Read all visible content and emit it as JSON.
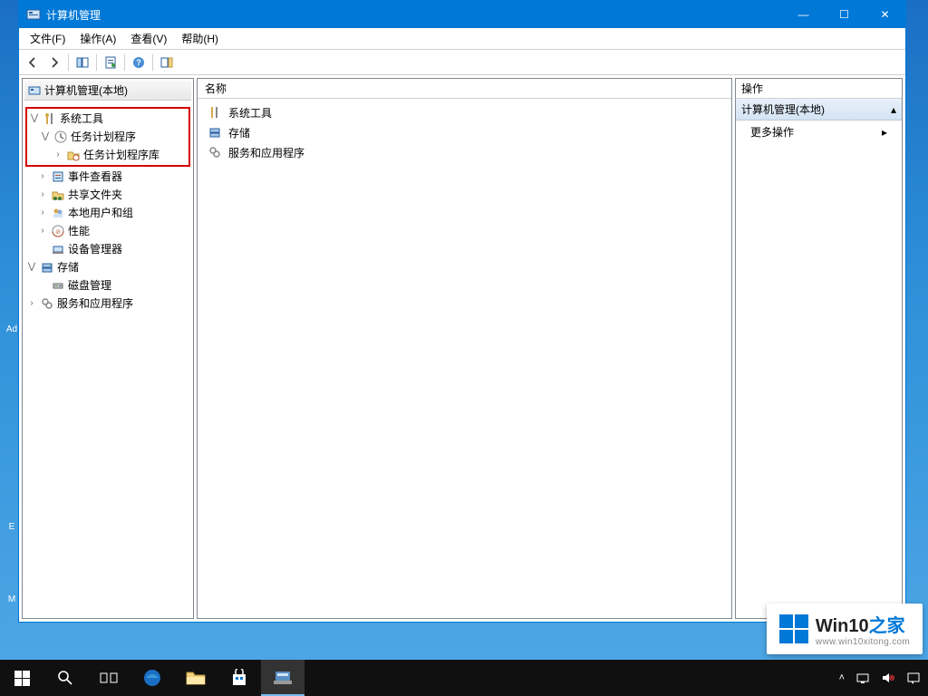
{
  "window": {
    "title": "计算机管理",
    "controls": {
      "min": "—",
      "max": "☐",
      "close": "✕"
    }
  },
  "menu": {
    "file": "文件(F)",
    "action": "操作(A)",
    "view": "查看(V)",
    "help": "帮助(H)"
  },
  "tree": {
    "root": "计算机管理(本地)",
    "system_tools": "系统工具",
    "task_scheduler": "任务计划程序",
    "task_scheduler_library": "任务计划程序库",
    "event_viewer": "事件查看器",
    "shared_folders": "共享文件夹",
    "local_users_groups": "本地用户和组",
    "performance": "性能",
    "device_manager": "设备管理器",
    "storage": "存储",
    "disk_management": "磁盘管理",
    "services_apps": "服务和应用程序"
  },
  "center": {
    "header": "名称",
    "items": {
      "system_tools": "系统工具",
      "storage": "存储",
      "services_apps": "服务和应用程序"
    }
  },
  "actions": {
    "header": "操作",
    "group": "计算机管理(本地)",
    "more": "更多操作"
  },
  "watermark": {
    "brand_a": "Win10",
    "brand_b": "之家",
    "url": "www.win10xitong.com"
  },
  "desktop": {
    "ad": "Ad",
    "e": "E",
    "m": "M"
  }
}
